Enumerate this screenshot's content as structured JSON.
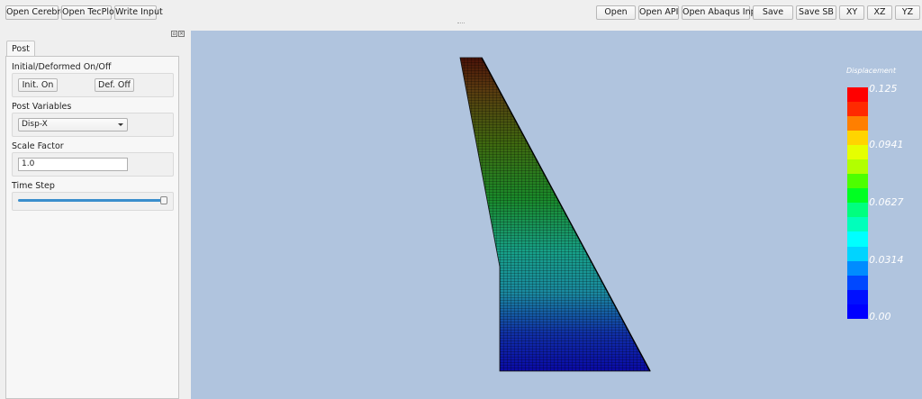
{
  "toolbar": {
    "left_buttons": [
      "Open Cerebro",
      "Open TecPlot",
      "Write Input"
    ],
    "right_buttons": [
      "Open",
      "Open API",
      "Open Abaqus Input",
      "Save",
      "Save SB",
      "XY",
      "XZ",
      "YZ"
    ]
  },
  "post_panel": {
    "tab_label": "Post",
    "sections": {
      "initial_deformed": {
        "label": "Initial/Deformed On/Off",
        "init_button": "Init. On",
        "def_button": "Def. Off"
      },
      "post_variables": {
        "label": "Post Variables",
        "selected": "Disp-X"
      },
      "scale_factor": {
        "label": "Scale Factor",
        "value": "1.0"
      },
      "time_step": {
        "label": "Time Step",
        "value_fraction": 1.0
      }
    }
  },
  "viewport": {
    "background": "#b0c4de",
    "legend": {
      "title": "Displacement",
      "labels": [
        "0.125",
        "0.0941",
        "0.0627",
        "0.0314",
        "0.00"
      ],
      "colors": [
        "#ff0000",
        "#ff2a00",
        "#ff7f00",
        "#ffd400",
        "#e6ff00",
        "#b2ff00",
        "#4dff00",
        "#00ff22",
        "#00ff7f",
        "#00ffbb",
        "#00ffff",
        "#00d4ff",
        "#008cff",
        "#0048ff",
        "#0010ff",
        "#0000ff"
      ]
    }
  }
}
